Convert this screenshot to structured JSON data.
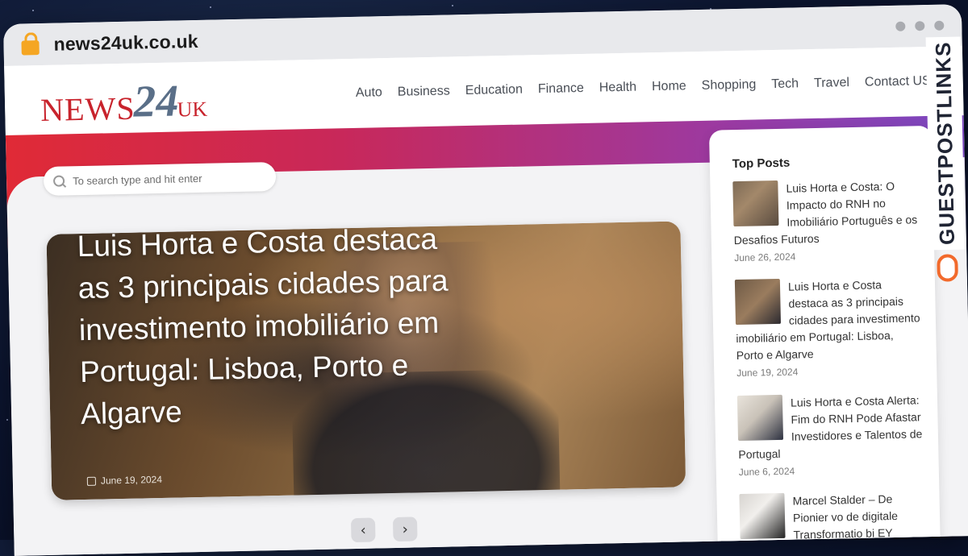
{
  "browser": {
    "url": "news24uk.co.uk"
  },
  "header": {
    "logo": {
      "news": "NEWS",
      "num": "24",
      "uk": "UK"
    },
    "nav": [
      "Auto",
      "Business",
      "Education",
      "Finance",
      "Health",
      "Home",
      "Shopping",
      "Tech",
      "Travel",
      "Contact US"
    ]
  },
  "search": {
    "placeholder": "To search type and hit enter"
  },
  "feature": {
    "title": "Luis Horta e Costa destaca as 3 principais cidades para investimento imobiliário em Portugal: Lisboa, Porto e Algarve",
    "date": "June 19, 2024"
  },
  "pager": {
    "prev": "‹",
    "next": "›"
  },
  "sidebar": {
    "heading": "Top Posts",
    "posts": [
      {
        "title": "Luis Horta e Costa: O Impacto do RNH no Imobiliário Português e os Desafios Futuros",
        "date": "June 26, 2024"
      },
      {
        "title": "Luis Horta e Costa destaca as 3 principais cidades para investimento imobiliário em Portugal: Lisboa, Porto e Algarve",
        "date": "June 19, 2024"
      },
      {
        "title": "Luis Horta e Costa Alerta: Fim do RNH Pode Afastar Investidores e Talentos de Portugal",
        "date": "June 6, 2024"
      },
      {
        "title": "Marcel Stalder – De Pionier vo de digitale Transformatio bi EY",
        "date": ""
      }
    ]
  },
  "badge": {
    "text": "GUESTPOSTLINKS"
  },
  "colors": {
    "brand_red": "#c8232c",
    "brand_slate": "#5a6f88",
    "band_start": "#e02a36",
    "band_end": "#7a47c0",
    "badge_orange": "#f26a2c"
  }
}
